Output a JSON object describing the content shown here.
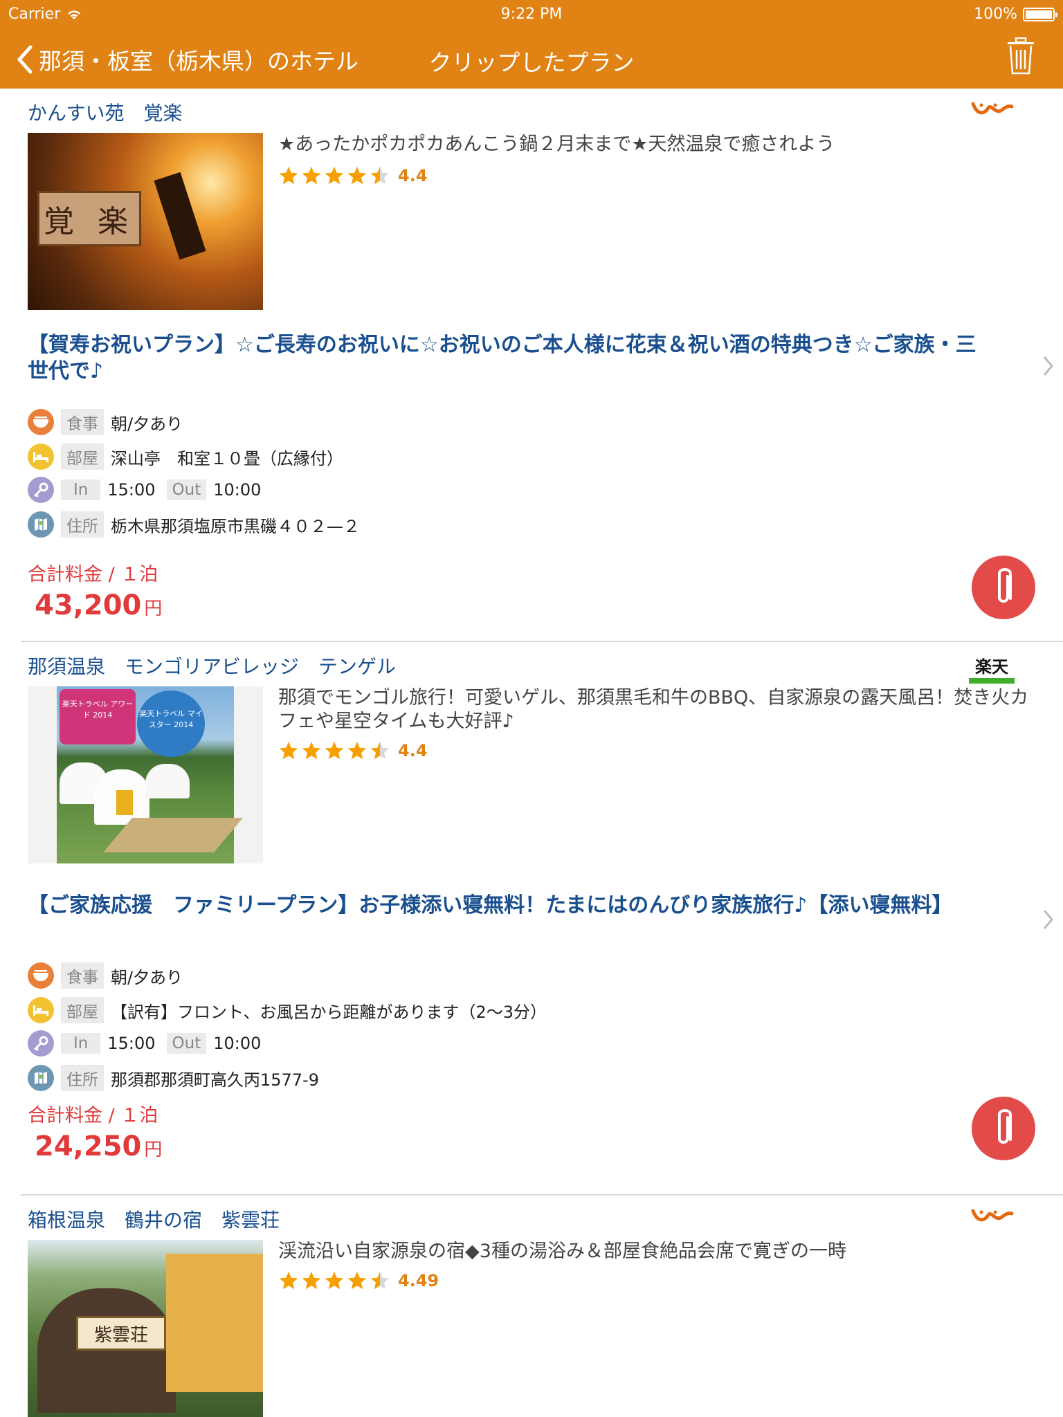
{
  "status_bar": {
    "carrier": "Carrier",
    "time": "9:22 PM",
    "battery": "100%"
  },
  "nav": {
    "back_label": "那須・板室（栃木県）のホテル",
    "title": "クリップしたプラン"
  },
  "labels": {
    "meal": "食事",
    "room": "部屋",
    "in": "In",
    "out": "Out",
    "address": "住所",
    "total": "合計料金 / １泊",
    "yen": "円"
  },
  "hotels": [
    {
      "name": "かんすい苑　覚楽",
      "source": "jalan-logo",
      "catch": "★あったかポカポカあんこう鍋２月末まで★天然温泉で癒されよう",
      "rating": "4.4",
      "rating_value": 4.4,
      "plan_title": "【賀寿お祝いプラン】☆ご長寿のお祝いに☆お祝いのご本人様に花束＆祝い酒の特典つき☆ご家族・三世代で♪",
      "meal": "朝/夕あり",
      "room": "深山亭　和室１０畳（広縁付）",
      "checkin": "15:00",
      "checkout": "10:00",
      "address": "栃木県那須塩原市黒磯４０２—２",
      "price": "43,200",
      "thumb_text": "覚 楽"
    },
    {
      "name": "那須温泉　モンゴリアビレッジ　テンゲル",
      "source": "rakuten-logo",
      "source_text": "楽天",
      "catch": "那須でモンゴル旅行！可愛いゲル、那須黒毛和牛のBBQ、自家源泉の露天風呂！焚き火カフェや星空タイムも大好評♪",
      "rating": "4.4",
      "rating_value": 4.4,
      "plan_title": "【ご家族応援　ファミリープラン】お子様添い寝無料！たまにはのんびり家族旅行♪【添い寝無料】",
      "meal": "朝/夕あり",
      "room": "【訳有】フロント、お風呂から距離があります（2〜3分）",
      "checkin": "15:00",
      "checkout": "10:00",
      "address": "那須郡那須町高久丙1577-9",
      "price": "24,250",
      "badge1": "楽天トラベル アワード 2014",
      "badge2": "楽天トラベル マイスター 2014"
    },
    {
      "name": "箱根温泉　鶴井の宿　紫雲荘",
      "source": "jalan-logo",
      "catch": "渓流沿い自家源泉の宿◆3種の湯浴み＆部屋食絶品会席で寛ぎの一時",
      "rating": "4.49",
      "rating_value": 4.49,
      "thumb_text": "紫雲荘"
    }
  ],
  "colors": {
    "header": "#e08214",
    "title_blue": "#1a4f8f",
    "price_red": "#e03a3a",
    "star": "#f5a000"
  }
}
